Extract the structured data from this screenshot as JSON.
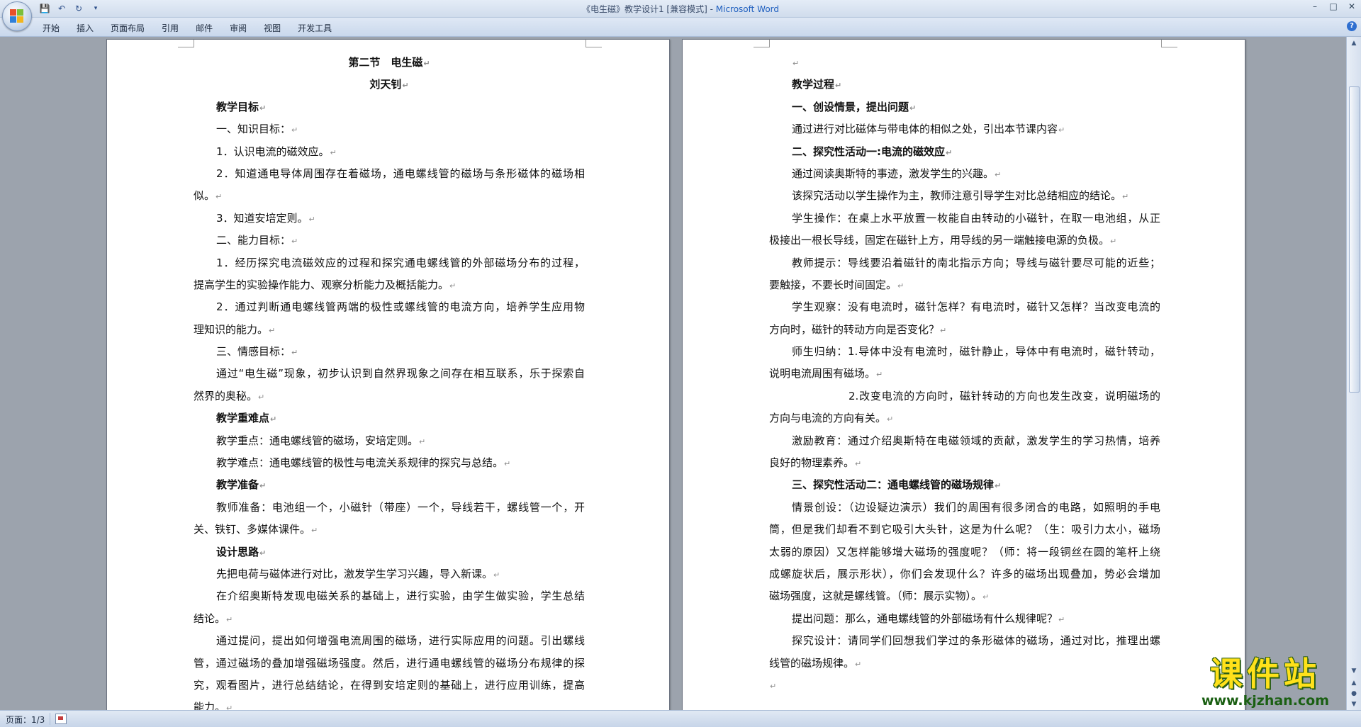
{
  "window": {
    "title_doc": "《电生磁》教学设计1 [兼容模式]",
    "title_sep": " - ",
    "title_app": "Microsoft Word",
    "minimize": "–",
    "maximize": "□",
    "close": "✕"
  },
  "quick_access": {
    "save": "💾",
    "undo": "↶",
    "redo": "↻",
    "customize": "▾"
  },
  "ribbon": {
    "tabs": [
      "开始",
      "插入",
      "页面布局",
      "引用",
      "邮件",
      "审阅",
      "视图",
      "开发工具"
    ],
    "help": "?"
  },
  "pilcrow": "↵",
  "page_left": {
    "lines": [
      {
        "text": "第二节　电生磁",
        "style": "center bold",
        "pm": true
      },
      {
        "text": "刘天钊",
        "style": "center bold",
        "pm": true
      },
      {
        "text": "教学目标",
        "style": "indent bold",
        "pm": true
      },
      {
        "text": "一、知识目标：",
        "style": "indent",
        "pm": true
      },
      {
        "text": "1．认识电流的磁效应。",
        "style": "indent",
        "pm": true
      },
      {
        "text": "2．知道通电导体周围存在着磁场，通电螺线管的磁场与条形磁体的磁场相",
        "style": "indent justify-wrap",
        "pm": false
      },
      {
        "text": "似。",
        "style": "",
        "pm": true
      },
      {
        "text": "3．知道安培定则。",
        "style": "indent",
        "pm": true
      },
      {
        "text": "二、能力目标：",
        "style": "indent",
        "pm": true
      },
      {
        "text": "1．经历探究电流磁效应的过程和探究通电螺线管的外部磁场分布的过程，",
        "style": "indent justify-wrap",
        "pm": false
      },
      {
        "text": "提高学生的实验操作能力、观察分析能力及概括能力。",
        "style": "",
        "pm": true
      },
      {
        "text": "2．通过判断通电螺线管两端的极性或螺线管的电流方向，培养学生应用物",
        "style": "indent justify-wrap",
        "pm": false
      },
      {
        "text": "理知识的能力。",
        "style": "",
        "pm": true
      },
      {
        "text": "三、情感目标：",
        "style": "indent",
        "pm": true
      },
      {
        "text": "通过“电生磁”现象，初步认识到自然界现象之间存在相互联系，乐于探索自",
        "style": "indent justify-wrap",
        "pm": false
      },
      {
        "text": "然界的奥秘。",
        "style": "",
        "pm": true
      },
      {
        "text": "教学重难点",
        "style": "indent bold",
        "pm": true
      },
      {
        "text": "教学重点：通电螺线管的磁场，安培定则。",
        "style": "indent",
        "pm": true
      },
      {
        "text": "教学难点：通电螺线管的极性与电流关系规律的探究与总结。",
        "style": "indent",
        "pm": true
      },
      {
        "text": "教学准备",
        "style": "indent bold",
        "pm": true
      },
      {
        "text": "教师准备：电池组一个，小磁针（带座）一个，导线若干，螺线管一个，开",
        "style": "indent justify-wrap",
        "pm": false
      },
      {
        "text": "关、铁钉、多媒体课件。",
        "style": "",
        "pm": true
      },
      {
        "text": "设计思路",
        "style": "indent bold",
        "pm": true
      },
      {
        "text": "先把电荷与磁体进行对比，激发学生学习兴趣，导入新课。",
        "style": "indent",
        "pm": true
      },
      {
        "text": "在介绍奥斯特发现电磁关系的基础上，进行实验，由学生做实验，学生总结",
        "style": "indent justify-wrap",
        "pm": false
      },
      {
        "text": "结论。",
        "style": "",
        "pm": true
      },
      {
        "text": "通过提问，提出如何增强电流周围的磁场，进行实际应用的问题。引出螺线",
        "style": "indent justify-wrap",
        "pm": false
      },
      {
        "text": "管，通过磁场的叠加增强磁场强度。然后，进行通电螺线管的磁场分布规律的探",
        "style": "justify-wrap",
        "pm": false
      },
      {
        "text": "究，观看图片，进行总结结论，在得到安培定则的基础上，进行应用训练，提高",
        "style": "justify-wrap",
        "pm": false
      },
      {
        "text": "能力。",
        "style": "",
        "pm": true
      }
    ]
  },
  "page_right": {
    "lines": [
      {
        "text": "",
        "style": "indent",
        "pm": true
      },
      {
        "text": "教学过程",
        "style": "indent bold",
        "pm": true
      },
      {
        "text": "一、创设情景，提出问题",
        "style": "indent bold",
        "pm": true
      },
      {
        "text": "通过进行对比磁体与带电体的相似之处，引出本节课内容",
        "style": "indent",
        "pm": true
      },
      {
        "text": "二、探究性活动一:电流的磁效应",
        "style": "indent bold",
        "pm": true
      },
      {
        "text": "通过阅读奥斯特的事迹，激发学生的兴趣。",
        "style": "indent",
        "pm": true
      },
      {
        "text": "该探究活动以学生操作为主，教师注意引导学生对比总结相应的结论。",
        "style": "indent",
        "pm": true
      },
      {
        "text": "学生操作：在桌上水平放置一枚能自由转动的小磁针，在取一电池组，从正",
        "style": "indent justify-wrap",
        "pm": false
      },
      {
        "text": "极接出一根长导线，固定在磁针上方，用导线的另一端触接电源的负极。",
        "style": "",
        "pm": true
      },
      {
        "text": "教师提示：导线要沿着磁针的南北指示方向；导线与磁针要尽可能的近些；",
        "style": "indent justify-wrap",
        "pm": false
      },
      {
        "text": "要触接，不要长时间固定。",
        "style": "",
        "pm": true
      },
      {
        "text": "学生观察：没有电流时，磁针怎样？有电流时，磁针又怎样？当改变电流的",
        "style": "indent justify-wrap",
        "pm": false
      },
      {
        "text": "方向时，磁针的转动方向是否变化？",
        "style": "",
        "pm": true
      },
      {
        "text": "师生归纳：1.导体中没有电流时，磁针静止，导体中有电流时，磁针转动，",
        "style": "indent justify-wrap",
        "pm": false
      },
      {
        "text": "说明电流周围有磁场。",
        "style": "",
        "pm": true
      },
      {
        "text": "2.改变电流的方向时，磁针转动的方向也发生改变，说明磁场的",
        "style": "indent2 justify-wrap",
        "pm": false
      },
      {
        "text": "方向与电流的方向有关。",
        "style": "",
        "pm": true
      },
      {
        "text": "激励教育：通过介绍奥斯特在电磁领域的贡献，激发学生的学习热情，培养",
        "style": "indent justify-wrap",
        "pm": false
      },
      {
        "text": "良好的物理素养。",
        "style": "",
        "pm": true
      },
      {
        "text": "三、探究性活动二：通电螺线管的磁场规律",
        "style": "indent bold",
        "pm": true
      },
      {
        "text": "情景创设：（边设疑边演示）我们的周围有很多闭合的电路，如照明的手电",
        "style": "indent justify-wrap",
        "pm": false
      },
      {
        "text": "筒，但是我们却看不到它吸引大头针，这是为什么呢？（生：吸引力太小，磁场",
        "style": "justify-wrap",
        "pm": false
      },
      {
        "text": "太弱的原因）又怎样能够增大磁场的强度呢？（师：将一段铜丝在圆的笔杆上绕",
        "style": "justify-wrap",
        "pm": false
      },
      {
        "text": "成螺旋状后，展示形状），你们会发现什么？许多的磁场出现叠加，势必会增加",
        "style": "justify-wrap",
        "pm": false
      },
      {
        "text": "磁场强度，这就是螺线管。（师：展示实物）。",
        "style": "",
        "pm": true
      },
      {
        "text": "提出问题：那么，通电螺线管的外部磁场有什么规律呢？",
        "style": "indent",
        "pm": true
      },
      {
        "text": "探究设计：请同学们回想我们学过的条形磁体的磁场，通过对比，推理出螺",
        "style": "indent justify-wrap",
        "pm": false
      },
      {
        "text": "线管的磁场规律。",
        "style": "",
        "pm": true
      },
      {
        "text": "",
        "style": "",
        "pm": true
      }
    ]
  },
  "scrollbar": {
    "up": "▲",
    "down": "▼",
    "prev": "▲",
    "select": "●",
    "next": "▼"
  },
  "status": {
    "page": "页面：1/3"
  },
  "watermark": {
    "title": "课件站",
    "url": "www.kjzhan.com"
  },
  "colors": {
    "title_app": "#1f5fbf",
    "watermark_yellow": "#ffe11a",
    "watermark_green": "#1a5f12"
  }
}
